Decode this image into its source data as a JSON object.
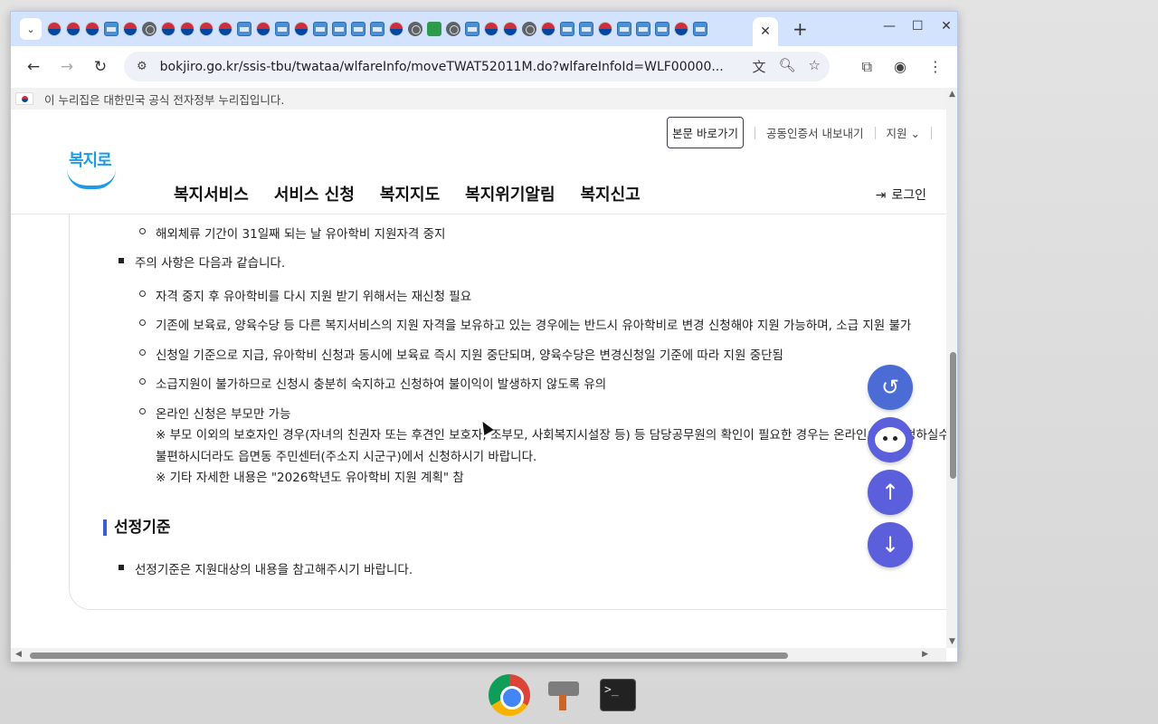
{
  "browser": {
    "active_tab_close": "✕",
    "new_tab": "+",
    "url": "bokjiro.go.kr/ssis-tbu/twataa/wlfareInfo/moveTWAT52011M.do?wlfareInfoId=WLF00000..."
  },
  "gov_banner": "이 누리집은 대한민국 공식 전자정부 누리집입니다.",
  "header": {
    "skip_link": "본문 바로가기",
    "cert_export": "공동인증서 내보내기",
    "support": "지원",
    "logo_text": "복지로",
    "nav": [
      "복지서비스",
      "서비스 신청",
      "복지지도",
      "복지위기알림",
      "복지신고"
    ],
    "login": "로그인"
  },
  "content": {
    "top_item": "해외체류 기간이 31일째 되는 날 유아학비 지원자격 중지",
    "notice_heading": "주의 사항은 다음과 같습니다.",
    "notice_items": [
      "자격 중지 후 유아학비를 다시 지원 받기 위해서는 재신청 필요",
      "기존에 보육료, 양육수당 등 다른 복지서비스의 지원 자격을 보유하고 있는 경우에는 반드시 유아학비로 변경 신청해야 지원 가능하며, 소급 지원 불가",
      "신청일 기준으로 지급, 유아학비 신청과 동시에 보육료 즉시 지원 중단되며, 양육수당은 변경신청일 기준에 따라 지원 중단됨",
      "소급지원이 불가하므로 신청시 충분히 숙지하고 신청하여 불이익이 발생하지 않도록 유의",
      "온라인 신청은 부모만 가능"
    ],
    "online_note_line1": "※ 부모 이외의 보호자인 경우(자녀의 친권자 또는 후견인 보호자, 조부모, 사회복지시설장 등) 등 담당공무원의 확인이 필요한 경우는 온라인으로 신청하실수",
    "online_note_line2": "불편하시더라도 읍면동 주민센터(주소지 시군구)에서 신청하시기 바랍니다.",
    "online_note_line3": "※ 기타 자세한 내용은 \"2026학년도 유아학비 지원 계획\" 참",
    "section_title": "선정기준",
    "section_item": "선정기준은 지원대상의 내용을 참고해주시기 바랍니다."
  }
}
